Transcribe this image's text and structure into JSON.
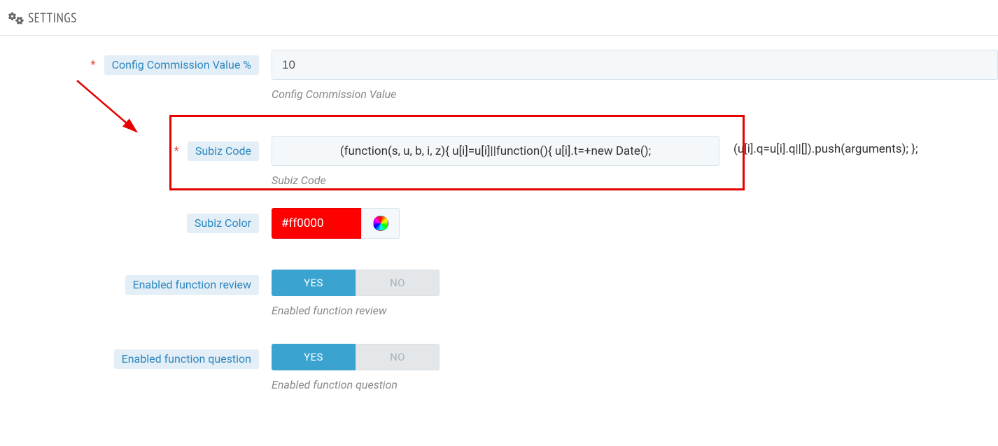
{
  "header": {
    "title": "SETTINGS"
  },
  "fields": {
    "commission": {
      "required": "*",
      "label": "Config Commission Value %",
      "value": "10",
      "help": "Config Commission Value"
    },
    "subiz_code": {
      "required": "*",
      "label": "Subiz Code",
      "value": "(function(s, u, b, i, z){ u[i]=u[i]||function(){ u[i].t=+new Date();",
      "trailing_text": "(u[i].q=u[i].q||[]).push(arguments); };",
      "help": "Subiz Code"
    },
    "subiz_color": {
      "label": "Subiz Color",
      "value": "#ff0000"
    },
    "review": {
      "label": "Enabled function review",
      "help": "Enabled function review",
      "yes": "YES",
      "no": "NO"
    },
    "question": {
      "label": "Enabled function question",
      "help": "Enabled function question",
      "yes": "YES",
      "no": "NO"
    }
  }
}
